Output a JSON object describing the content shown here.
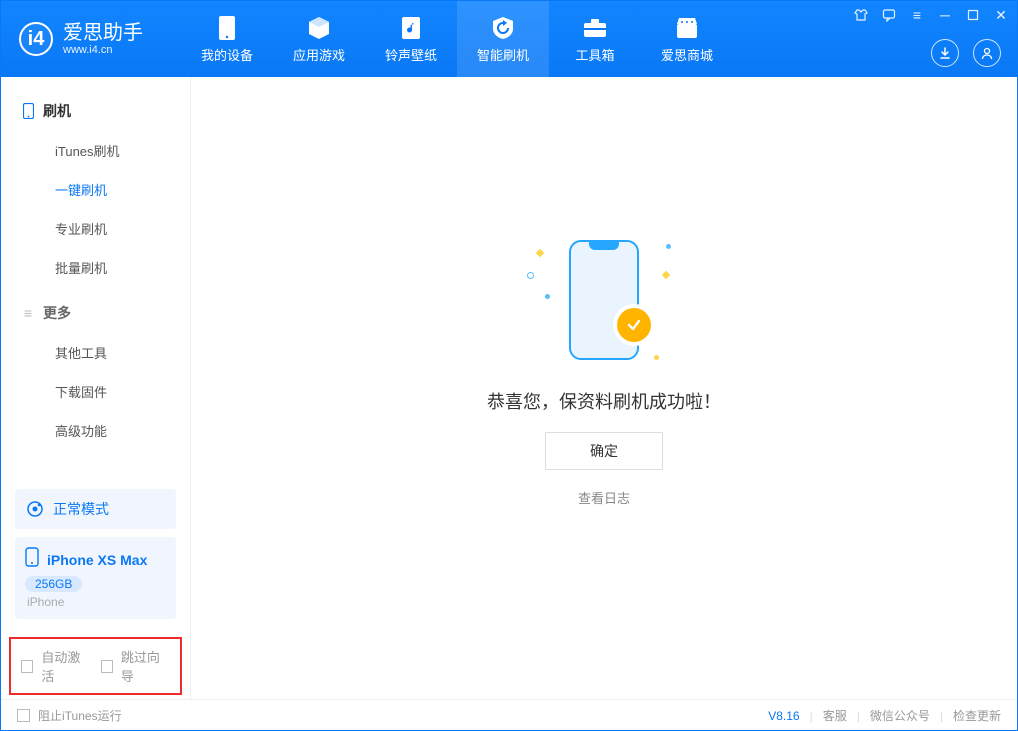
{
  "app": {
    "name": "爱思助手",
    "url": "www.i4.cn",
    "version": "V8.16"
  },
  "navtabs": [
    {
      "label": "我的设备"
    },
    {
      "label": "应用游戏"
    },
    {
      "label": "铃声壁纸"
    },
    {
      "label": "智能刷机"
    },
    {
      "label": "工具箱"
    },
    {
      "label": "爱思商城"
    }
  ],
  "sidebar": {
    "group1": {
      "title": "刷机",
      "items": [
        "iTunes刷机",
        "一键刷机",
        "专业刷机",
        "批量刷机"
      ]
    },
    "group2": {
      "title": "更多",
      "items": [
        "其他工具",
        "下载固件",
        "高级功能"
      ]
    }
  },
  "device": {
    "mode": "正常模式",
    "name": "iPhone XS Max",
    "size": "256GB",
    "type": "iPhone"
  },
  "checks": {
    "auto_activate": "自动激活",
    "skip_guide": "跳过向导"
  },
  "main": {
    "success_text": "恭喜您，保资料刷机成功啦！",
    "confirm": "确定",
    "view_log": "查看日志"
  },
  "footer": {
    "block_itunes": "阻止iTunes运行",
    "support": "客服",
    "wechat": "微信公众号",
    "update": "检查更新"
  }
}
